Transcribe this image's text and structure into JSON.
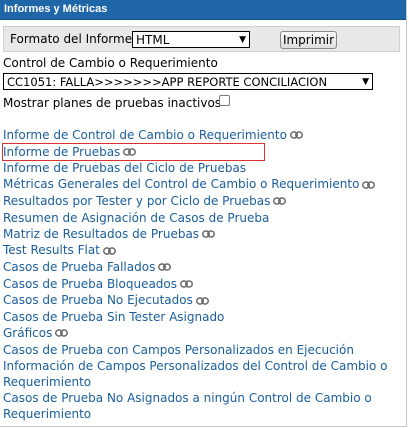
{
  "header": {
    "title": "Informes y Métricas"
  },
  "toolbar": {
    "format_label": "Formato del Informe",
    "format_value": "HTML",
    "print_label": "Imprimir"
  },
  "requirement": {
    "label": "Control de Cambio o Requerimiento",
    "value": "CC1051: FALLA>>>>>>>APP REPORTE CONCILIACION"
  },
  "inactive": {
    "label": "Mostrar planes de pruebas inactivos",
    "checked": false
  },
  "links": [
    {
      "label": "Informe de Control de Cambio o Requerimiento",
      "icon": "chain-link-icon"
    },
    {
      "label": "Informe de Pruebas",
      "icon": "chain-link-icon",
      "highlighted": true
    },
    {
      "label": "Informe de Pruebas del Ciclo de Pruebas"
    },
    {
      "label": "Métricas Generales del Control de Cambio o Requerimiento",
      "icon": "chain-link-icon"
    },
    {
      "label": "Resultados por Tester y por Ciclo de Pruebas",
      "icon": "chain-link-icon"
    },
    {
      "label": "Resumen de Asignación de Casos de Prueba"
    },
    {
      "label": "Matriz de Resultados de Pruebas",
      "icon": "chain-link-icon"
    },
    {
      "label": "Test Results Flat",
      "icon": "chain-link-icon"
    },
    {
      "label": "Casos de Prueba Fallados",
      "icon": "chain-link-icon"
    },
    {
      "label": "Casos de Prueba Bloqueados",
      "icon": "chain-link-icon"
    },
    {
      "label": "Casos de Prueba No Ejecutados",
      "icon": "chain-link-icon"
    },
    {
      "label": "Casos de Prueba Sin Tester Asignado"
    },
    {
      "label": "Gráficos",
      "icon": "chain-link-icon"
    },
    {
      "label": "Casos de Prueba con Campos Personalizados en Ejecución"
    },
    {
      "label": "Información de Campos Personalizados del Control de Cambio o Requerimiento"
    },
    {
      "label": "Casos de Prueba No Asignados a ningún Control de Cambio o Requerimiento"
    }
  ],
  "colors": {
    "header_bg": "#1f66a8",
    "link": "#1a5e9c",
    "highlight_border": "#d9322f"
  }
}
